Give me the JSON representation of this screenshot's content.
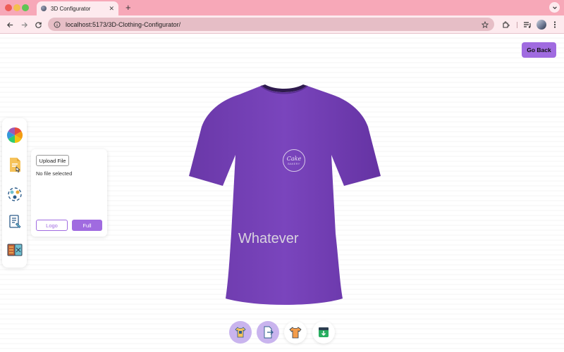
{
  "browser": {
    "tab_title": "3D Configurator",
    "tab_close": "✕",
    "new_tab": "+",
    "url": "localhost:5173/3D-Clothing-Configurator/"
  },
  "colors": {
    "accent": "#a06be0",
    "shirt": "#7340b4",
    "tab_bar": "#f7a8b8"
  },
  "header": {
    "go_back_label": "Go Back"
  },
  "sidebar": {
    "items": [
      {
        "icon": "color-wheel-icon"
      },
      {
        "icon": "file-picker-icon",
        "active": true
      },
      {
        "icon": "ai-picker-icon"
      },
      {
        "icon": "text-editor-icon"
      },
      {
        "icon": "texture-picker-icon"
      }
    ]
  },
  "file_picker": {
    "upload_label": "Upload File",
    "status": "No file selected",
    "logo_label": "Logo",
    "full_label": "Full"
  },
  "shirt": {
    "logo_text": "Cake",
    "logo_subtext": "BAKERY",
    "decal_text": "Whatever"
  },
  "bottom_bar": {
    "items": [
      {
        "icon": "shirt-logo-toggle-icon",
        "active": true
      },
      {
        "icon": "shirt-texture-toggle-icon",
        "active": true
      },
      {
        "icon": "tshirt-icon",
        "active": false
      },
      {
        "icon": "download-icon",
        "active": false
      }
    ]
  }
}
